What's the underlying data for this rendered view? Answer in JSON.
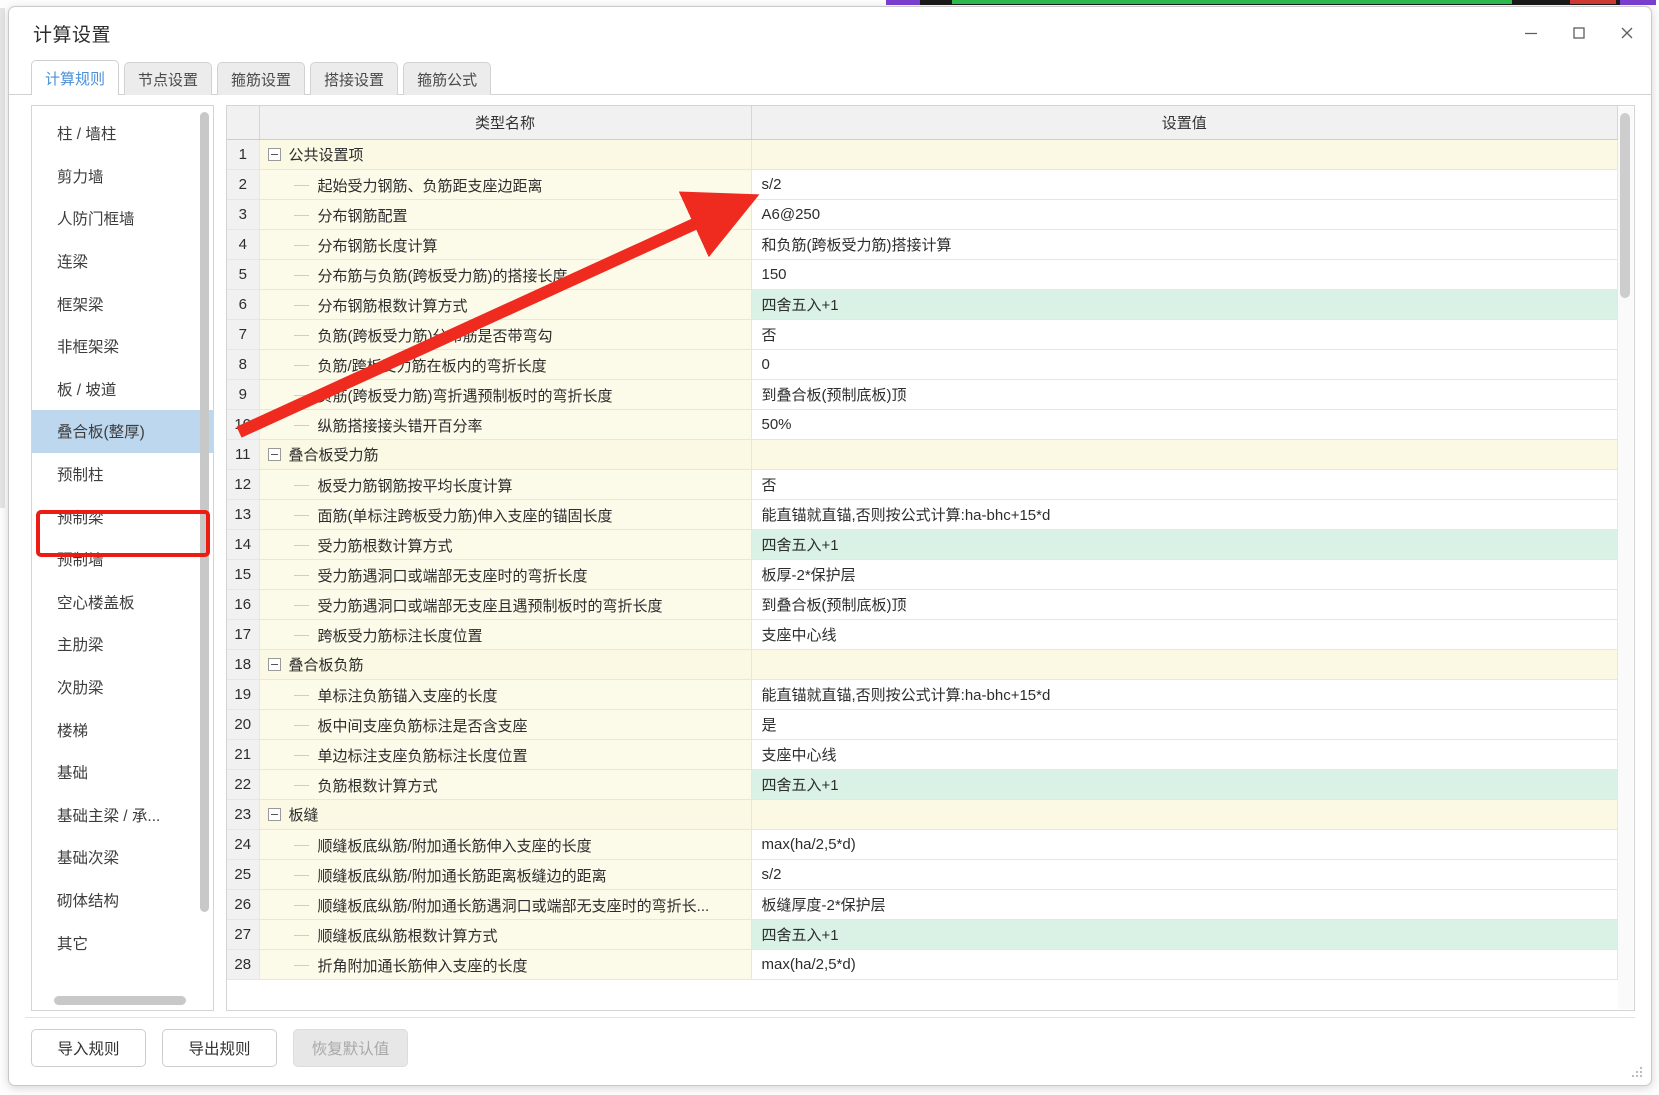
{
  "window": {
    "title": "计算设置",
    "controls": [
      {
        "name": "minimize",
        "label": "—"
      },
      {
        "name": "maximize",
        "label": "□"
      },
      {
        "name": "close",
        "label": "✕"
      }
    ]
  },
  "tabs": [
    {
      "label": "计算规则",
      "active": true
    },
    {
      "label": "节点设置",
      "active": false
    },
    {
      "label": "箍筋设置",
      "active": false
    },
    {
      "label": "搭接设置",
      "active": false
    },
    {
      "label": "箍筋公式",
      "active": false
    }
  ],
  "sidebar": {
    "items": [
      {
        "label": "柱 / 墙柱",
        "selected": false
      },
      {
        "label": "剪力墙",
        "selected": false
      },
      {
        "label": "人防门框墙",
        "selected": false
      },
      {
        "label": "连梁",
        "selected": false
      },
      {
        "label": "框架梁",
        "selected": false
      },
      {
        "label": "非框架梁",
        "selected": false
      },
      {
        "label": "板 / 坡道",
        "selected": false
      },
      {
        "label": "叠合板(整厚)",
        "selected": true
      },
      {
        "label": "预制柱",
        "selected": false
      },
      {
        "label": "预制梁",
        "selected": false
      },
      {
        "label": "预制墙",
        "selected": false
      },
      {
        "label": "空心楼盖板",
        "selected": false
      },
      {
        "label": "主肋梁",
        "selected": false
      },
      {
        "label": "次肋梁",
        "selected": false
      },
      {
        "label": "楼梯",
        "selected": false
      },
      {
        "label": "基础",
        "selected": false
      },
      {
        "label": "基础主梁 / 承...",
        "selected": false
      },
      {
        "label": "基础次梁",
        "selected": false
      },
      {
        "label": "砌体结构",
        "selected": false
      },
      {
        "label": "其它",
        "selected": false
      }
    ]
  },
  "grid": {
    "columns": [
      {
        "key": "num",
        "label": ""
      },
      {
        "key": "name",
        "label": "类型名称"
      },
      {
        "key": "value",
        "label": "设置值"
      }
    ],
    "rows": [
      {
        "num": "1",
        "kind": "group",
        "name": "公共设置项",
        "value": "",
        "highlight": false
      },
      {
        "num": "2",
        "kind": "leaf",
        "name": "起始受力钢筋、负筋距支座边距离",
        "value": "s/2",
        "highlight": false
      },
      {
        "num": "3",
        "kind": "leaf",
        "name": "分布钢筋配置",
        "value": "A6@250",
        "highlight": false
      },
      {
        "num": "4",
        "kind": "leaf",
        "name": "分布钢筋长度计算",
        "value": "和负筋(跨板受力筋)搭接计算",
        "highlight": false
      },
      {
        "num": "5",
        "kind": "leaf",
        "name": "分布筋与负筋(跨板受力筋)的搭接长度",
        "value": "150",
        "highlight": false
      },
      {
        "num": "6",
        "kind": "leaf",
        "name": "分布钢筋根数计算方式",
        "value": "四舍五入+1",
        "highlight": true
      },
      {
        "num": "7",
        "kind": "leaf",
        "name": "负筋(跨板受力筋)分布筋是否带弯勾",
        "value": "否",
        "highlight": false
      },
      {
        "num": "8",
        "kind": "leaf",
        "name": "负筋/跨板受力筋在板内的弯折长度",
        "value": "0",
        "highlight": false
      },
      {
        "num": "9",
        "kind": "leaf",
        "name": "负筋(跨板受力筋)弯折遇预制板时的弯折长度",
        "value": "到叠合板(预制底板)顶",
        "highlight": false
      },
      {
        "num": "10",
        "kind": "leaf",
        "name": "纵筋搭接接头错开百分率",
        "value": "50%",
        "highlight": false
      },
      {
        "num": "11",
        "kind": "group",
        "name": "叠合板受力筋",
        "value": "",
        "highlight": false
      },
      {
        "num": "12",
        "kind": "leaf",
        "name": "板受力筋钢筋按平均长度计算",
        "value": "否",
        "highlight": false
      },
      {
        "num": "13",
        "kind": "leaf",
        "name": "面筋(单标注跨板受力筋)伸入支座的锚固长度",
        "value": "能直锚就直锚,否则按公式计算:ha-bhc+15*d",
        "highlight": false
      },
      {
        "num": "14",
        "kind": "leaf",
        "name": "受力筋根数计算方式",
        "value": "四舍五入+1",
        "highlight": true
      },
      {
        "num": "15",
        "kind": "leaf",
        "name": "受力筋遇洞口或端部无支座时的弯折长度",
        "value": "板厚-2*保护层",
        "highlight": false
      },
      {
        "num": "16",
        "kind": "leaf",
        "name": "受力筋遇洞口或端部无支座且遇预制板时的弯折长度",
        "value": "到叠合板(预制底板)顶",
        "highlight": false
      },
      {
        "num": "17",
        "kind": "leaf",
        "name": "跨板受力筋标注长度位置",
        "value": "支座中心线",
        "highlight": false
      },
      {
        "num": "18",
        "kind": "group",
        "name": "叠合板负筋",
        "value": "",
        "highlight": false
      },
      {
        "num": "19",
        "kind": "leaf",
        "name": "单标注负筋锚入支座的长度",
        "value": "能直锚就直锚,否则按公式计算:ha-bhc+15*d",
        "highlight": false
      },
      {
        "num": "20",
        "kind": "leaf",
        "name": "板中间支座负筋标注是否含支座",
        "value": "是",
        "highlight": false
      },
      {
        "num": "21",
        "kind": "leaf",
        "name": "单边标注支座负筋标注长度位置",
        "value": "支座中心线",
        "highlight": false
      },
      {
        "num": "22",
        "kind": "leaf",
        "name": "负筋根数计算方式",
        "value": "四舍五入+1",
        "highlight": true
      },
      {
        "num": "23",
        "kind": "group",
        "name": "板缝",
        "value": "",
        "highlight": false
      },
      {
        "num": "24",
        "kind": "leaf",
        "name": "顺缝板底纵筋/附加通长筋伸入支座的长度",
        "value": "max(ha/2,5*d)",
        "highlight": false
      },
      {
        "num": "25",
        "kind": "leaf",
        "name": "顺缝板底纵筋/附加通长筋距离板缝边的距离",
        "value": "s/2",
        "highlight": false
      },
      {
        "num": "26",
        "kind": "leaf",
        "name": "顺缝板底纵筋/附加通长筋遇洞口或端部无支座时的弯折长...",
        "value": "板缝厚度-2*保护层",
        "highlight": false
      },
      {
        "num": "27",
        "kind": "leaf",
        "name": "顺缝板底纵筋根数计算方式",
        "value": "四舍五入+1",
        "highlight": true
      },
      {
        "num": "28",
        "kind": "leaf",
        "name": "折角附加通长筋伸入支座的长度",
        "value": "max(ha/2,5*d)",
        "highlight": false
      }
    ]
  },
  "footer": {
    "buttons": [
      {
        "label": "导入规则",
        "disabled": false
      },
      {
        "label": "导出规则",
        "disabled": false
      },
      {
        "label": "恢复默认值",
        "disabled": true
      }
    ]
  },
  "annotation": {
    "arrow_color": "#ef2b20",
    "highlight_box_color": "#ec1c12"
  }
}
